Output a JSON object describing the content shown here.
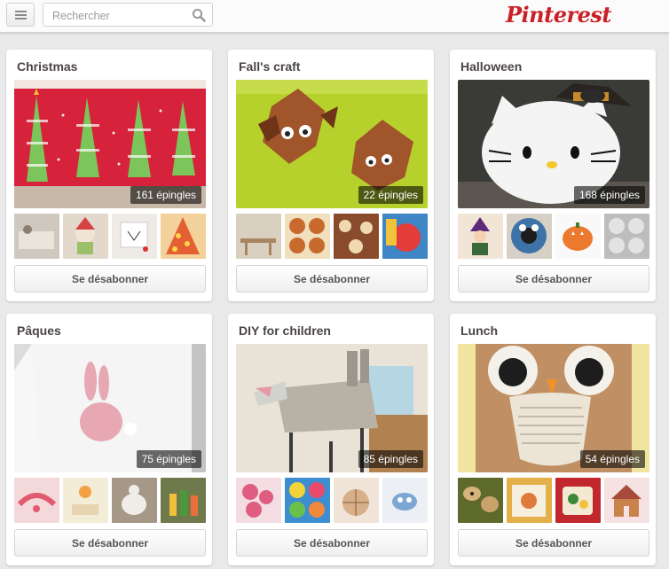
{
  "header": {
    "search_placeholder": "Rechercher",
    "logo_text": "Pinterest",
    "logo_color": "#cb2027"
  },
  "boards": [
    {
      "title": "Christmas",
      "count": "161 épingles",
      "button": "Se désabonner",
      "cover_desc": "red paper christmas tree crafts",
      "thumb_colors": [
        "#c9c3b9",
        "#d8cfc4",
        "#e6e2dc",
        "#e2b08a"
      ]
    },
    {
      "title": "Fall's craft",
      "count": "22 épingles",
      "button": "Se désabonner",
      "cover_desc": "leaf animals on green paper",
      "thumb_colors": [
        "#cfc6b4",
        "#d7a56a",
        "#b46a4a",
        "#4a8fc7"
      ]
    },
    {
      "title": "Halloween",
      "count": "168 épingles",
      "button": "Se désabonner",
      "cover_desc": "hello kitty pumpkin",
      "thumb_colors": [
        "#3c2a24",
        "#3e73a8",
        "#e8793a",
        "#a9a9a9"
      ]
    },
    {
      "title": "Pâques",
      "count": "75 épingles",
      "button": "Se désabonner",
      "cover_desc": "bunny t-shirt",
      "thumb_colors": [
        "#e96b7e",
        "#f1e3c0",
        "#b7a58d",
        "#6a7a4a"
      ]
    },
    {
      "title": "DIY for children",
      "count": "85 épingles",
      "button": "Se désabonner",
      "cover_desc": "chair horse costume",
      "thumb_colors": [
        "#e7a3b1",
        "#3d8ed0",
        "#d9b8a0",
        "#7ea6d2"
      ]
    },
    {
      "title": "Lunch",
      "count": "54 épingles",
      "button": "Se désabonner",
      "cover_desc": "owl paper bag",
      "thumb_colors": [
        "#5e6a2c",
        "#e4b04a",
        "#c1272d",
        "#a84a3a"
      ]
    }
  ]
}
